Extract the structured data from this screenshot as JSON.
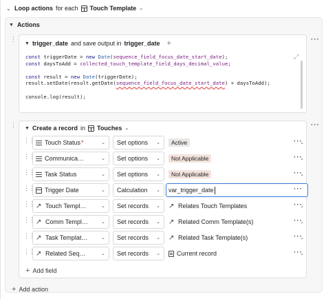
{
  "loop": {
    "prefix": "Loop actions",
    "connector": "for each",
    "table": "Touch Template"
  },
  "actions": {
    "title": "Actions"
  },
  "script_step": {
    "var_name": "trigger_date",
    "middle": "and save output in",
    "output": "trigger_date",
    "code_lines": [
      [
        "const triggerDate = new Date(sequence_field_focus_date_start_date);"
      ],
      [
        "const daysToAdd = collected_touch_template_field_days_decimal_value;"
      ],
      [
        ""
      ],
      [
        "const result = new Date(triggerDate);"
      ],
      [
        "result.setDate(result.getDate(sequence_field_focus_date_start_date) + daysToAdd);"
      ],
      [
        ""
      ],
      [
        "console.log(result);"
      ]
    ]
  },
  "create_step": {
    "prefix": "Create a record",
    "in": "in",
    "table": "Touches",
    "rows": [
      {
        "field": "Touch Status",
        "required": "*",
        "icon": "list-icon",
        "op": "Set options",
        "value": "Active",
        "value_type": "tag"
      },
      {
        "field": "Communica…",
        "required": "",
        "icon": "list-icon",
        "op": "Set options",
        "value": "Not Applicable",
        "value_type": "tag-na"
      },
      {
        "field": "Task Status",
        "required": "",
        "icon": "list-icon",
        "op": "Set options",
        "value": "Not Applicable",
        "value_type": "tag-na"
      },
      {
        "field": "Trigger Date",
        "required": "",
        "icon": "calendar-icon",
        "op": "Calculation",
        "value": "var_trigger_date",
        "value_type": "input"
      },
      {
        "field": "Touch Templ…",
        "required": "",
        "icon": "link-arrow-icon",
        "op": "Set records",
        "value": "Relates Touch Templates",
        "value_type": "link"
      },
      {
        "field": "Comm Templ…",
        "required": "",
        "icon": "link-arrow-icon",
        "op": "Set records",
        "value": "Related Comm Template(s)",
        "value_type": "link"
      },
      {
        "field": "Task Templat…",
        "required": "",
        "icon": "link-arrow-icon",
        "op": "Set records",
        "value": "Related Task Template(s)",
        "value_type": "link"
      },
      {
        "field": "Related Seq…",
        "required": "",
        "icon": "link-arrow-icon",
        "op": "Set records",
        "value": "Current record",
        "value_type": "doc"
      }
    ],
    "add_field": "Add field"
  },
  "add_action": "Add action"
}
